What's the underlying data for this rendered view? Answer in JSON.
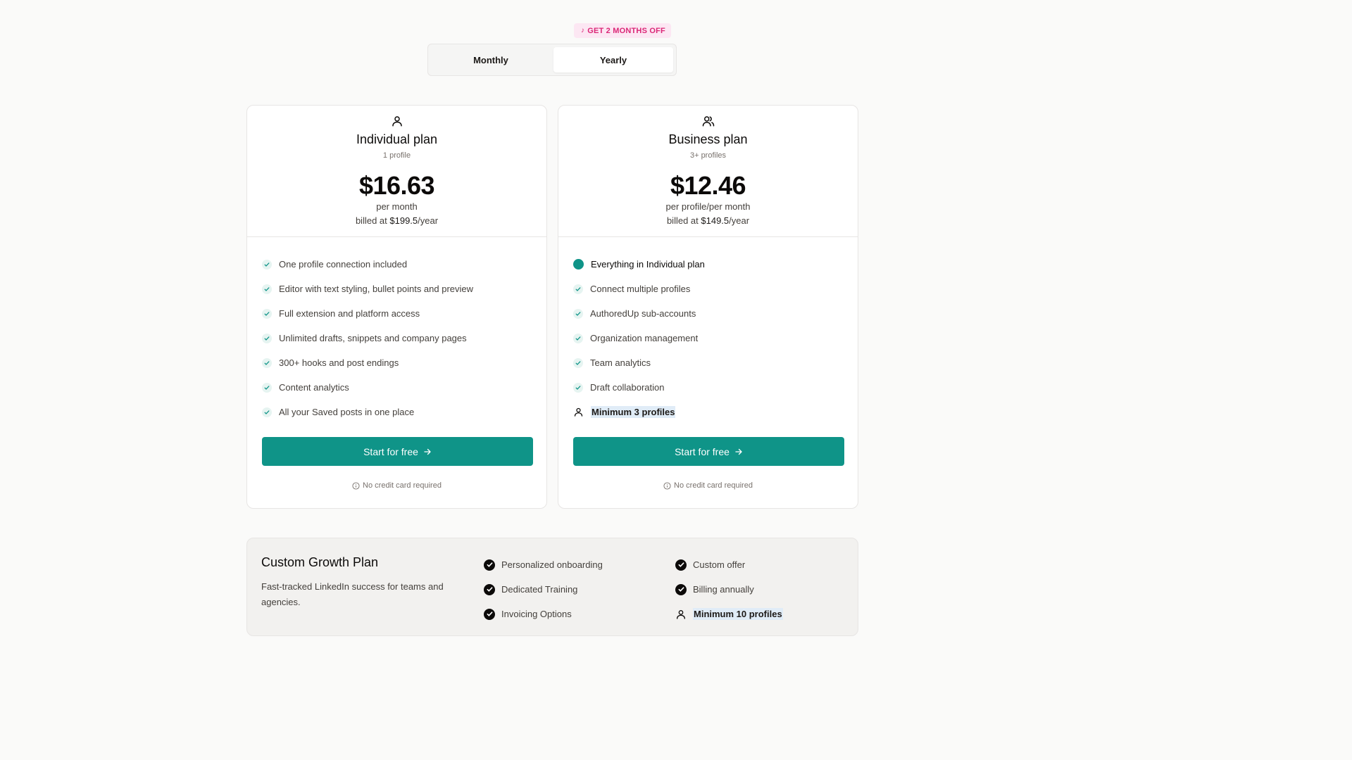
{
  "colors": {
    "accent": "#0f9488",
    "promo_bg": "#fce7f3",
    "promo_text": "#db2777",
    "highlight_bg": "#e0ecf7"
  },
  "billing": {
    "promo_badge": "GET 2 MONTHS OFF",
    "options": [
      "Monthly",
      "Yearly"
    ],
    "selected": "Yearly"
  },
  "plans": {
    "individual": {
      "icon": "user-icon",
      "title": "Individual plan",
      "subtitle": "1 profile",
      "price": "$16.63",
      "period": "per month",
      "billed_prefix": "billed at ",
      "billed_amount": "$199.5",
      "billed_suffix": "/year",
      "features": [
        "One profile connection included",
        "Editor with text styling, bullet points and preview",
        "Full extension and platform access",
        "Unlimited drafts, snippets and company pages",
        "300+ hooks and post endings",
        "Content analytics",
        "All your Saved posts in one place"
      ],
      "cta": "Start for free",
      "note": "No credit card required"
    },
    "business": {
      "icon": "users-icon",
      "title": "Business plan",
      "subtitle": "3+ profiles",
      "price": "$12.46",
      "period": "per profile/per month",
      "billed_prefix": "billed at ",
      "billed_amount": "$149.5",
      "billed_suffix": "/year",
      "lead_feature_prefix": "Everything in ",
      "lead_feature_bold": "Individual plan",
      "features": [
        "Connect multiple profiles",
        "AuthoredUp sub-accounts",
        "Organization management",
        "Team analytics",
        "Draft collaboration"
      ],
      "minimum": "Minimum 3 profiles",
      "cta": "Start for free",
      "note": "No credit card required"
    }
  },
  "growth": {
    "title": "Custom Growth Plan",
    "description": "Fast-tracked LinkedIn success for teams and agencies.",
    "col1": [
      "Personalized onboarding",
      "Dedicated Training",
      "Invoicing Options"
    ],
    "col2": [
      "Custom offer",
      "Billing annually"
    ],
    "minimum": "Minimum 10 profiles"
  }
}
